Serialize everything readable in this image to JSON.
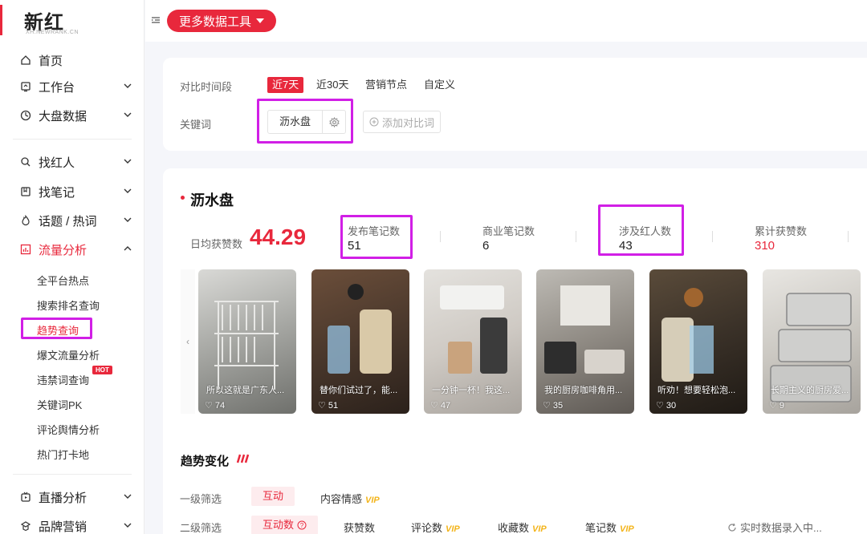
{
  "brand": {
    "name": "新红",
    "sub": "XH.NEWRANK.CN",
    "accent": "#e8283c",
    "highlight": "#d11fe6"
  },
  "sidebar": {
    "home": "首页",
    "workbench": "工作台",
    "market": "大盘数据",
    "find_kol": "找红人",
    "find_notes": "找笔记",
    "topics": "话题 / 热词",
    "traffic": "流量分析",
    "sub_items": [
      "全平台热点",
      "搜索排名查询",
      "趋势查询",
      "爆文流量分析",
      "违禁词查询",
      "关键词PK",
      "评论舆情分析",
      "热门打卡地"
    ],
    "hot_badge": "HOT",
    "live": "直播分析",
    "brand_marketing": "品牌营销"
  },
  "topbar": {
    "tools_label": "更多数据工具"
  },
  "filter": {
    "period_label": "对比时间段",
    "periods": [
      "近7天",
      "近30天",
      "营销节点",
      "自定义"
    ],
    "keyword_label": "关键词",
    "keyword": "沥水盘",
    "add_compare": "添加对比词"
  },
  "summary": {
    "keyword_title": "沥水盘",
    "avg_likes_label": "日均获赞数",
    "avg_likes_value": "44.29",
    "stats": [
      {
        "label": "发布笔记数",
        "value": "51"
      },
      {
        "label": "商业笔记数",
        "value": "6"
      },
      {
        "label": "涉及红人数",
        "value": "43"
      },
      {
        "label": "累计获赞数",
        "value": "310"
      }
    ]
  },
  "notes": [
    {
      "caption": "所以这就是广东人...",
      "likes": "74"
    },
    {
      "caption": "替你们试过了，能...",
      "likes": "51"
    },
    {
      "caption": "一分钟一杯！我这...",
      "likes": "47"
    },
    {
      "caption": "我的厨房咖啡角用...",
      "likes": "35"
    },
    {
      "caption": "听劝！想要轻松泡...",
      "likes": "30"
    },
    {
      "caption": "长期主义的厨房爱...",
      "likes": "9"
    }
  ],
  "trend": {
    "title": "趋势变化",
    "level1_label": "一级筛选",
    "level1_active": "互动",
    "level1_sentiment": "内容情感",
    "level2_label": "二级筛选",
    "level2_active": "互动数",
    "level2_opts": [
      "获赞数",
      "评论数",
      "收藏数",
      "笔记数"
    ],
    "vip": "VIP",
    "realtime": "实时数据录入中..."
  }
}
